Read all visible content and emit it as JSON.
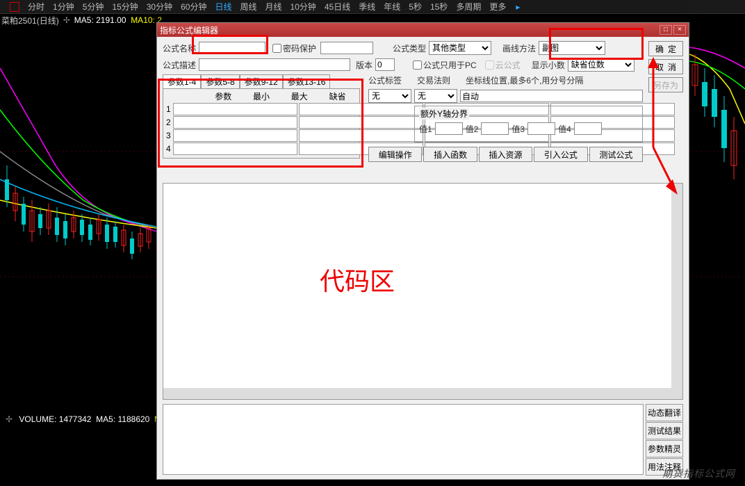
{
  "top_tabs": {
    "items": [
      "分时",
      "1分钟",
      "5分钟",
      "15分钟",
      "30分钟",
      "60分钟",
      "日线",
      "周线",
      "月线",
      "10分钟",
      "45日线",
      "季线",
      "年线",
      "5秒",
      "15秒",
      "多周期",
      "更多"
    ],
    "active_index": 6,
    "more_arrow": "▸"
  },
  "chart_info": {
    "symbol": "菜粕2501(日线)",
    "gear": "✢",
    "ma5_label": "MA5:",
    "ma5_value": "2191.00",
    "ma10_label": "MA10:",
    "ma10_value_partial": "2"
  },
  "volume_info": {
    "gear": "✢",
    "label": "VOLUME:",
    "value": "1477342",
    "ma5_label": "MA5:",
    "ma5_value": "1188620",
    "ma_tail": "MA"
  },
  "dialog": {
    "title": "指标公式编辑器",
    "close": "×",
    "max": "□",
    "name_label": "公式名称",
    "pwd_label": "密码保护",
    "type_label": "公式类型",
    "type_value": "其他类型",
    "method_label": "画线方法",
    "method_value": "副图",
    "desc_label": "公式描述",
    "version_label": "版本",
    "version_value": "0",
    "pc_only_label": "公式只用于PC",
    "cloud_label": "云公式",
    "decimal_label": "显示小数",
    "decimal_value": "缺省位数",
    "tag_label": "公式标签",
    "tag_value": "无",
    "rule_label": "交易法则",
    "rule_value": "无",
    "coord_label": "坐标线位置,最多6个,用分号分隔",
    "coord_value": "自动",
    "param_tabs": [
      "参数1-4",
      "参数5-8",
      "参数9-12",
      "参数13-16"
    ],
    "param_headers": [
      "参数",
      "最小",
      "最大",
      "缺省"
    ],
    "extra_y_title": "额外Y轴分界",
    "y_labels": [
      "值1",
      "值2",
      "值3",
      "值4"
    ],
    "action_buttons": [
      "编辑操作",
      "插入函数",
      "插入资源",
      "引入公式",
      "测试公式"
    ],
    "confirm": "确定",
    "cancel": "取消",
    "saveas": "另存为",
    "bottom_buttons": [
      "动态翻译",
      "测试结果",
      "参数精灵",
      "用法注释"
    ]
  },
  "annotations": {
    "code_area_label": "代码区"
  },
  "watermark": "期货指标公式网"
}
